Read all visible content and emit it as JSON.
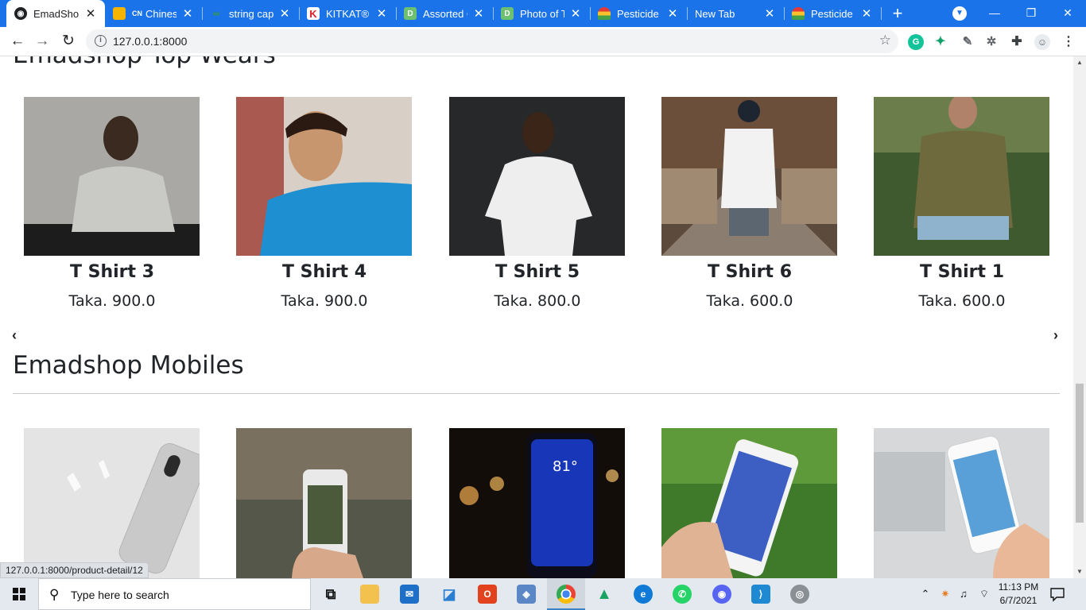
{
  "browser": {
    "tabs": [
      {
        "title": "EmadShop",
        "favicon": "site-icon",
        "color": "#202124",
        "active": true
      },
      {
        "title": "Chinese",
        "favicon": "cn-icon",
        "color": "#34a853",
        "active": false
      },
      {
        "title": "string capi",
        "favicon": "gg-icon",
        "color": "#3a9c3a",
        "active": false
      },
      {
        "title": "KITKAT® C",
        "favicon": "k-icon",
        "color": "#e11d2a",
        "active": false
      },
      {
        "title": "Assorted C",
        "favicon": "d-icon",
        "color": "#6cc070",
        "active": false
      },
      {
        "title": "Photo of Tr",
        "favicon": "d-icon",
        "color": "#6cc070",
        "active": false
      },
      {
        "title": "Pesticide fo",
        "favicon": "rainbow-icon",
        "color": "#f4b400",
        "active": false
      },
      {
        "title": "New Tab",
        "favicon": "",
        "color": "",
        "active": false
      },
      {
        "title": "Pesticide fo",
        "favicon": "rainbow-icon",
        "color": "#f4b400",
        "active": false
      }
    ],
    "url": "127.0.0.1:8000",
    "status_url": "127.0.0.1:8000/product-detail/12"
  },
  "page": {
    "top_section_title": "Emadshop Top Wears",
    "top_products": [
      {
        "name": "T Shirt 3",
        "price": "Taka. 900.0"
      },
      {
        "name": "T Shirt 4",
        "price": "Taka. 900.0"
      },
      {
        "name": "T Shirt 5",
        "price": "Taka. 800.0"
      },
      {
        "name": "T Shirt 6",
        "price": "Taka. 600.0"
      },
      {
        "name": "T Shirt 1",
        "price": "Taka. 600.0"
      }
    ],
    "mobiles_section_title": "Emadshop Mobiles",
    "prev_symbol": "‹",
    "next_symbol": "›"
  },
  "taskbar": {
    "search_placeholder": "Type here to search",
    "time": "11:13 PM",
    "date": "6/7/2021"
  },
  "colors": {
    "chrome_blue": "#1a73e8",
    "text": "#212529"
  }
}
